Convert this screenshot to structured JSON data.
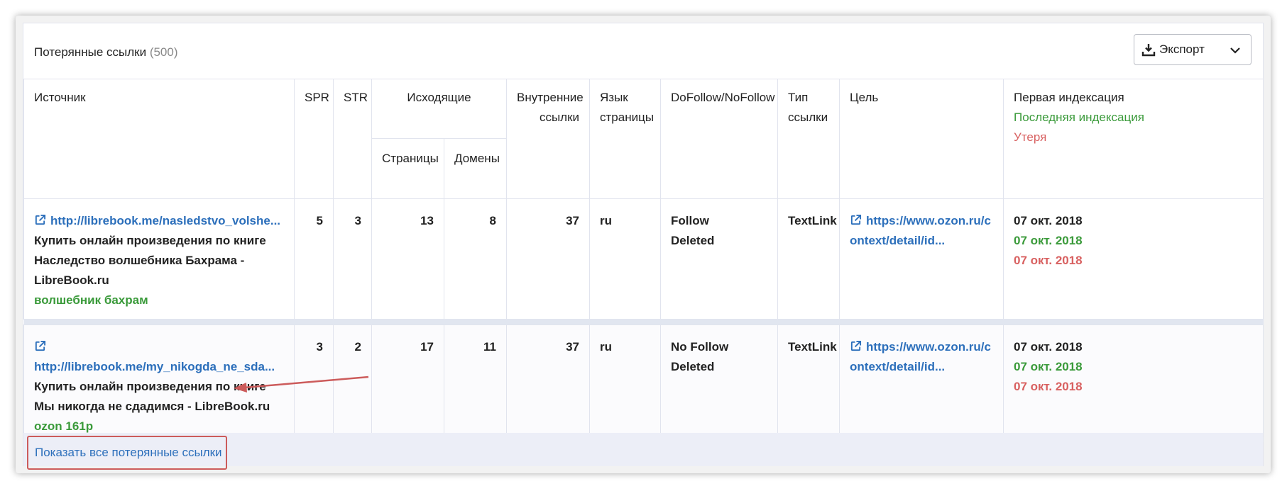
{
  "panel": {
    "title": "Потерянные ссылки",
    "count": "(500)",
    "export_label": "Экспорт"
  },
  "columns": {
    "source": "Источник",
    "spr": "SPR",
    "str": "STR",
    "outgoing": "Исходящие",
    "outgoing_pages": "Страницы",
    "outgoing_domains": "Домены",
    "internal": "Внутренние ссылки",
    "language": "Язык страницы",
    "dofollow": "DoFollow/NoFollow",
    "link_type": "Тип ссылки",
    "target": "Цель",
    "first_index": "Первая индексация",
    "last_index": "Последняя индексация",
    "lost": "Утеря"
  },
  "rows": [
    {
      "source_url": "http://librebook.me/nasledstvo_volshe...",
      "source_title": "Купить онлайн произведения по книге Наследство волшебника Бахрама - LibreBook.ru",
      "anchor": "волшебник бахрам",
      "spr": "5",
      "str": "3",
      "pages": "13",
      "domains": "8",
      "internal": "37",
      "language": "ru",
      "follow": "Follow",
      "status": "Deleted",
      "link_type": "TextLink",
      "target_url": "https://www.ozon.ru/context/detail/id...",
      "first_index": "07 окт. 2018",
      "last_index": "07 окт. 2018",
      "lost": "07 окт. 2018"
    },
    {
      "source_url": "http://librebook.me/my_nikogda_ne_sda...",
      "source_title": "Купить онлайн произведения по книге Мы никогда не сдадимся - LibreBook.ru",
      "anchor": "ozon 161р",
      "spr": "3",
      "str": "2",
      "pages": "17",
      "domains": "11",
      "internal": "37",
      "language": "ru",
      "follow": "No Follow",
      "status": "Deleted",
      "link_type": "TextLink",
      "target_url": "https://www.ozon.ru/context/detail/id...",
      "first_index": "07 окт. 2018",
      "last_index": "07 окт. 2018",
      "lost": "07 окт. 2018"
    }
  ],
  "footer": {
    "show_all": "Показать все потерянные ссылки"
  },
  "icons": {
    "export": "download-icon",
    "dropdown": "chevron-down-icon",
    "external": "external-link-icon"
  },
  "colors": {
    "link": "#2c6fbb",
    "green": "#3a9a3a",
    "red": "#d86060",
    "highlight_border": "#cc5b5b"
  }
}
